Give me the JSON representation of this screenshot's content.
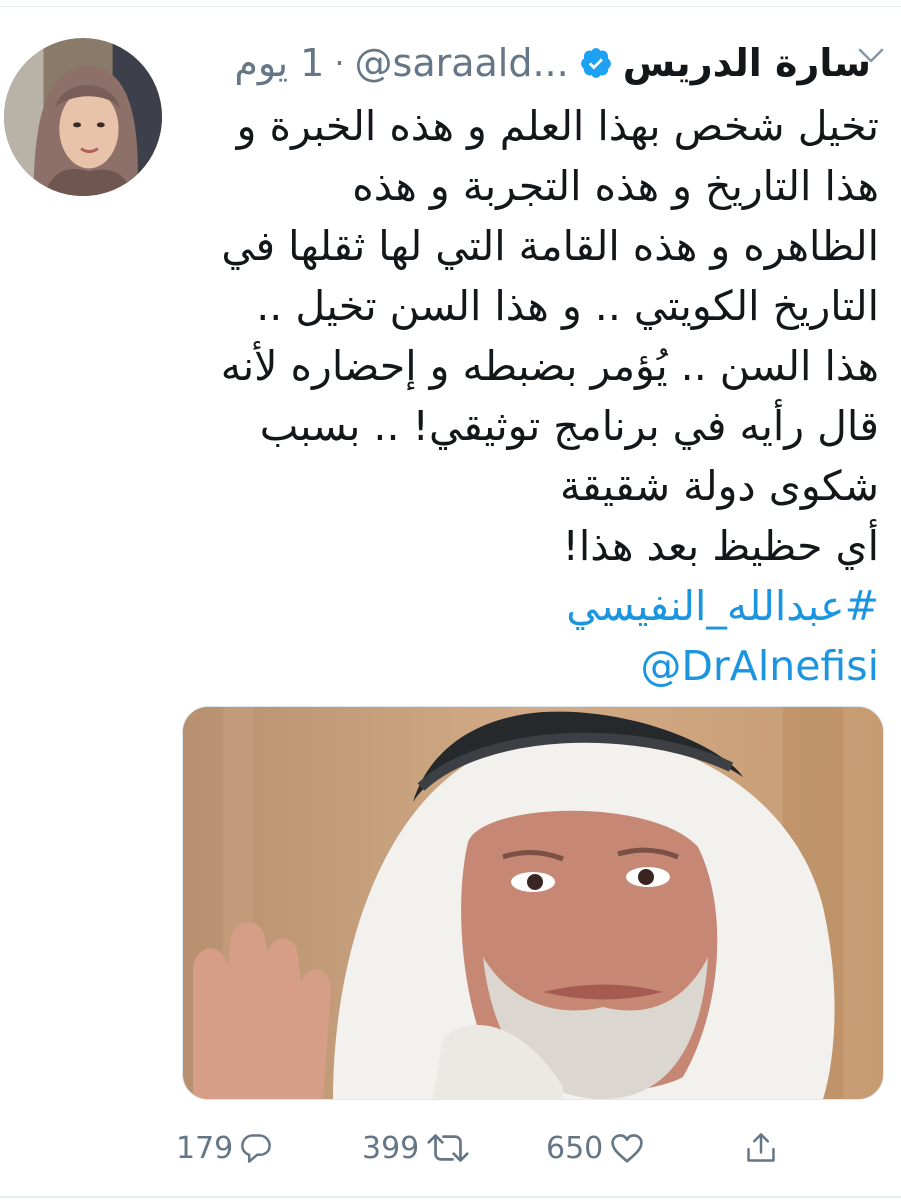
{
  "tweet": {
    "display_name": "سارة الدريس",
    "handle": "@saraald...",
    "separator": "·",
    "time": "1 يوم",
    "body_lines": [
      "تخيل شخص بهذا العلم و هذه الخبرة و",
      "هذا التاريخ و هذه التجربة و هذه",
      "الظاهره و هذه القامة التي لها ثقلها في",
      "التاريخ الكويتي .. و هذا السن تخيل ..",
      "هذا السن .. يُؤمر بضبطه و إحضاره لأنه",
      "قال رأيه في برنامج توثيقي! .. بسبب",
      "شكوى دولة شقيقة",
      "أي حظيظ بعد هذا!"
    ],
    "hashtag": "#عبدالله_النفيسي",
    "mention": "@DrAlnefisi",
    "replies": "179",
    "retweets": "399",
    "likes": "650"
  },
  "icons": {
    "verified": "verified-badge-icon",
    "chevron": "chevron-down-icon",
    "reply": "reply-icon",
    "retweet": "retweet-icon",
    "like": "heart-icon",
    "share": "share-icon"
  },
  "colors": {
    "accent": "#1b95e0",
    "text": "#14171a",
    "muted": "#657786"
  }
}
